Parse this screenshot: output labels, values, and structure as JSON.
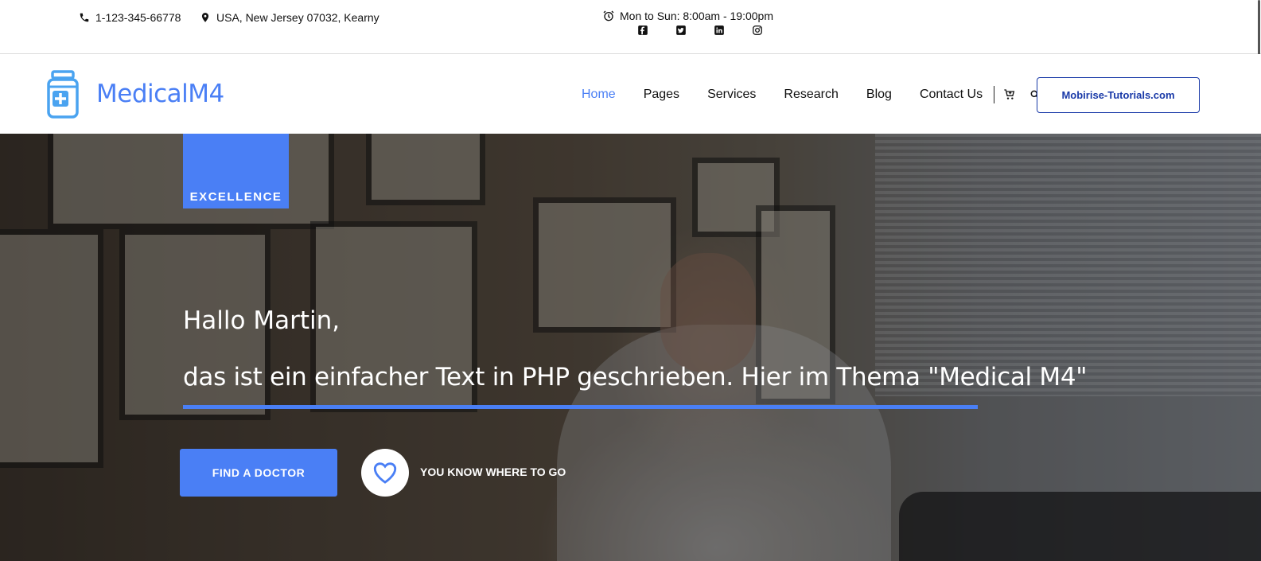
{
  "topbar": {
    "phone": "1-123-345-66778",
    "address": "USA, New Jersey 07032, Kearny",
    "hours": "Mon to Sun: 8:00am - 19:00pm",
    "socials": [
      "facebook-icon",
      "twitter-icon",
      "linkedin-icon",
      "instagram-icon"
    ]
  },
  "nav": {
    "brand": "MedicalM4",
    "items": [
      {
        "label": "Home",
        "active": true
      },
      {
        "label": "Pages"
      },
      {
        "label": "Services"
      },
      {
        "label": "Research"
      },
      {
        "label": "Blog"
      },
      {
        "label": "Contact Us"
      }
    ],
    "cta_label": "Mobirise-Tutorials.com"
  },
  "hero": {
    "tag": "EXCELLENCE",
    "greeting": "Hallo Martin,",
    "subline": "das ist ein einfacher Text in PHP geschrieben. Hier im Thema \"Medical M4\"",
    "button_label": "FIND A DOCTOR",
    "secondary_label": "YOU KNOW WHERE TO GO"
  },
  "colors": {
    "accent": "#4a7ff5",
    "cta_border": "#1a3aa8",
    "text": "#111111"
  }
}
